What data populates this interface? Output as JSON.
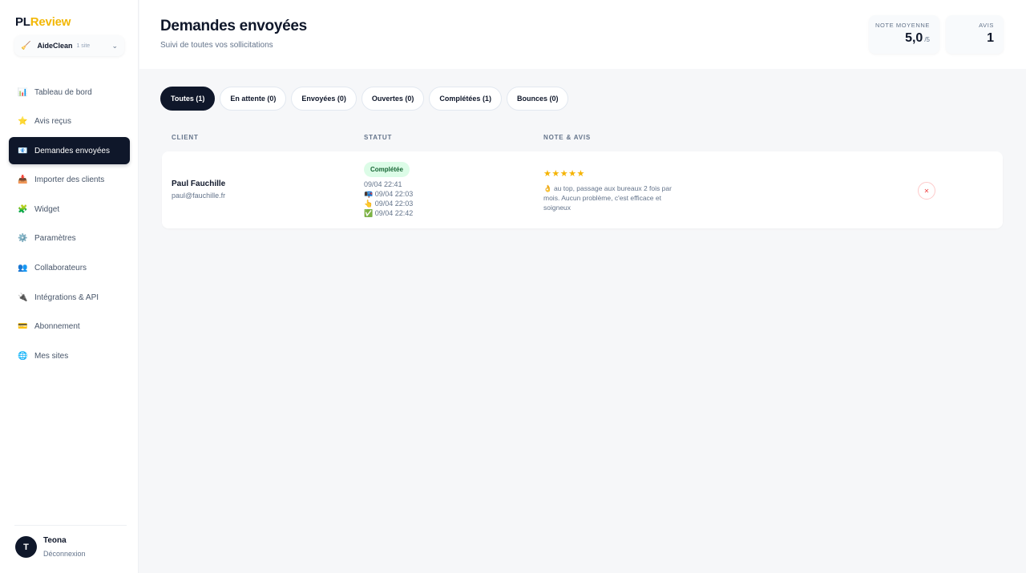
{
  "brand": {
    "part1": "PL",
    "part2": "Review",
    "accent": "#f2b705"
  },
  "site_selector": {
    "icon": "🧹",
    "name": "AideClean",
    "count": "1 site"
  },
  "sidebar": {
    "items": [
      {
        "icon": "📊",
        "label": "Tableau de bord"
      },
      {
        "icon": "⭐",
        "label": "Avis reçus"
      },
      {
        "icon": "📧",
        "label": "Demandes envoyées",
        "active": true
      },
      {
        "icon": "📥",
        "label": "Importer des clients"
      },
      {
        "icon": "🧩",
        "label": "Widget"
      },
      {
        "icon": "⚙️",
        "label": "Paramètres"
      },
      {
        "icon": "👥",
        "label": "Collaborateurs"
      },
      {
        "icon": "🔌",
        "label": "Intégrations & API"
      },
      {
        "icon": "💳",
        "label": "Abonnement"
      },
      {
        "icon": "🌐",
        "label": "Mes sites"
      }
    ]
  },
  "user": {
    "initial": "T",
    "name": "Teona",
    "logout": "Déconnexion"
  },
  "header": {
    "title": "Demandes envoyées",
    "subtitle": "Suivi de toutes vos sollicitations",
    "stats": {
      "note_label": "NOTE MOYENNE",
      "note_value": "5,0",
      "note_suffix": "/5",
      "avis_label": "AVIS",
      "avis_value": "1"
    }
  },
  "filters": [
    {
      "label": "Toutes (1)",
      "active": true
    },
    {
      "label": "En attente (0)"
    },
    {
      "label": "Envoyées (0)"
    },
    {
      "label": "Ouvertes (0)"
    },
    {
      "label": "Complétées (1)"
    },
    {
      "label": "Bounces (0)"
    }
  ],
  "table": {
    "headers": {
      "client": "CLIENT",
      "status": "STATUT",
      "review": "NOTE & AVIS"
    },
    "rows": [
      {
        "client_name": "Paul Fauchille",
        "client_email": "paul@fauchille.fr",
        "status": "Complétée",
        "timeline": [
          "09/04 22:41",
          "📭 09/04 22:03",
          "👆 09/04 22:03",
          "✅ 09/04 22:42"
        ],
        "stars": "★★★★★",
        "rating": 5,
        "review": "👌 au top, passage aux bureaux 2 fois par mois. Aucun problème, c'est efficace et soigneux",
        "delete_icon": "✕"
      }
    ]
  }
}
